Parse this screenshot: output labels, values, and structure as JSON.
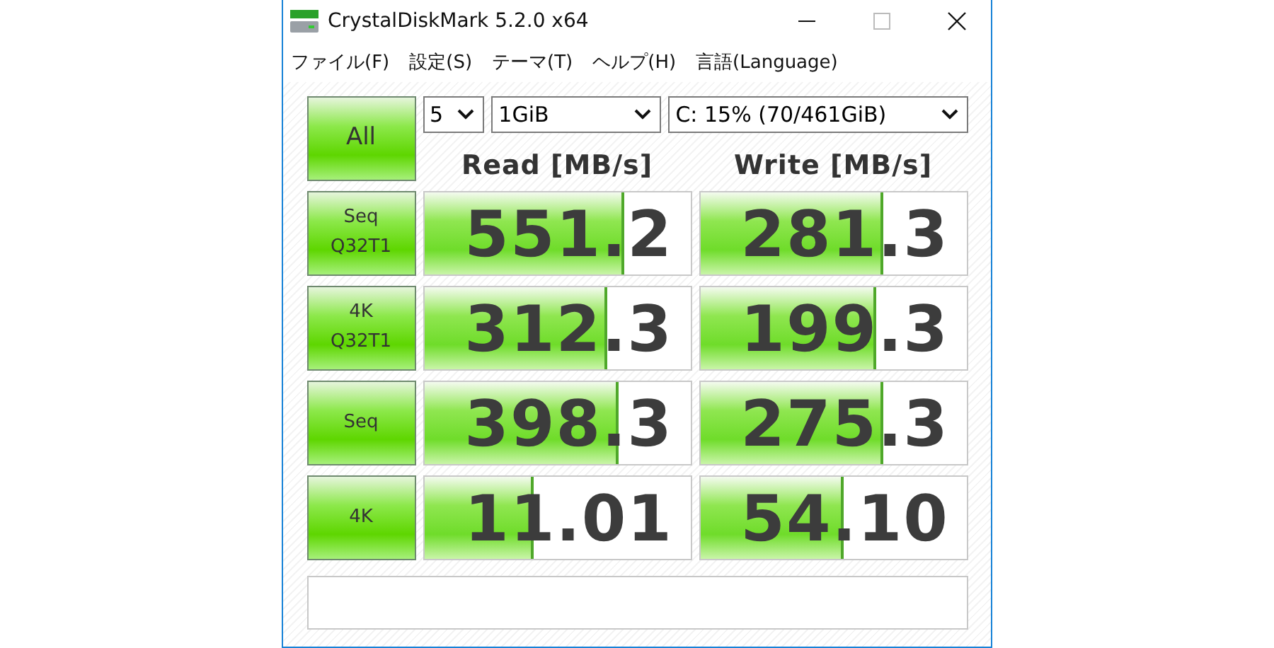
{
  "window": {
    "title": "CrystalDiskMark 5.2.0 x64"
  },
  "menu": [
    "ファイル(F)",
    "設定(S)",
    "テーマ(T)",
    "ヘルプ(H)",
    "言語(Language)"
  ],
  "all_button": "All",
  "selects": [
    {
      "kind": "count",
      "value": "5"
    },
    {
      "kind": "size",
      "value": "1GiB"
    },
    {
      "kind": "drive",
      "value": "C: 15% (70/461GiB)"
    }
  ],
  "columns": [
    "Read [MB/s]",
    "Write [MB/s]"
  ],
  "tests": [
    {
      "label": "Seq\nQ32T1",
      "read": {
        "value": "551.2",
        "level": 0.74
      },
      "write": {
        "value": "281.3",
        "level": 0.68
      }
    },
    {
      "label": "4K\nQ32T1",
      "read": {
        "value": "312.3",
        "level": 0.68
      },
      "write": {
        "value": "199.3",
        "level": 0.65
      }
    },
    {
      "label": "Seq",
      "read": {
        "value": "398.3",
        "level": 0.72
      },
      "write": {
        "value": "275.3",
        "level": 0.68
      }
    },
    {
      "label": "4K",
      "read": {
        "value": "11.01",
        "level": 0.4
      },
      "write": {
        "value": "54.10",
        "level": 0.53
      }
    }
  ]
}
